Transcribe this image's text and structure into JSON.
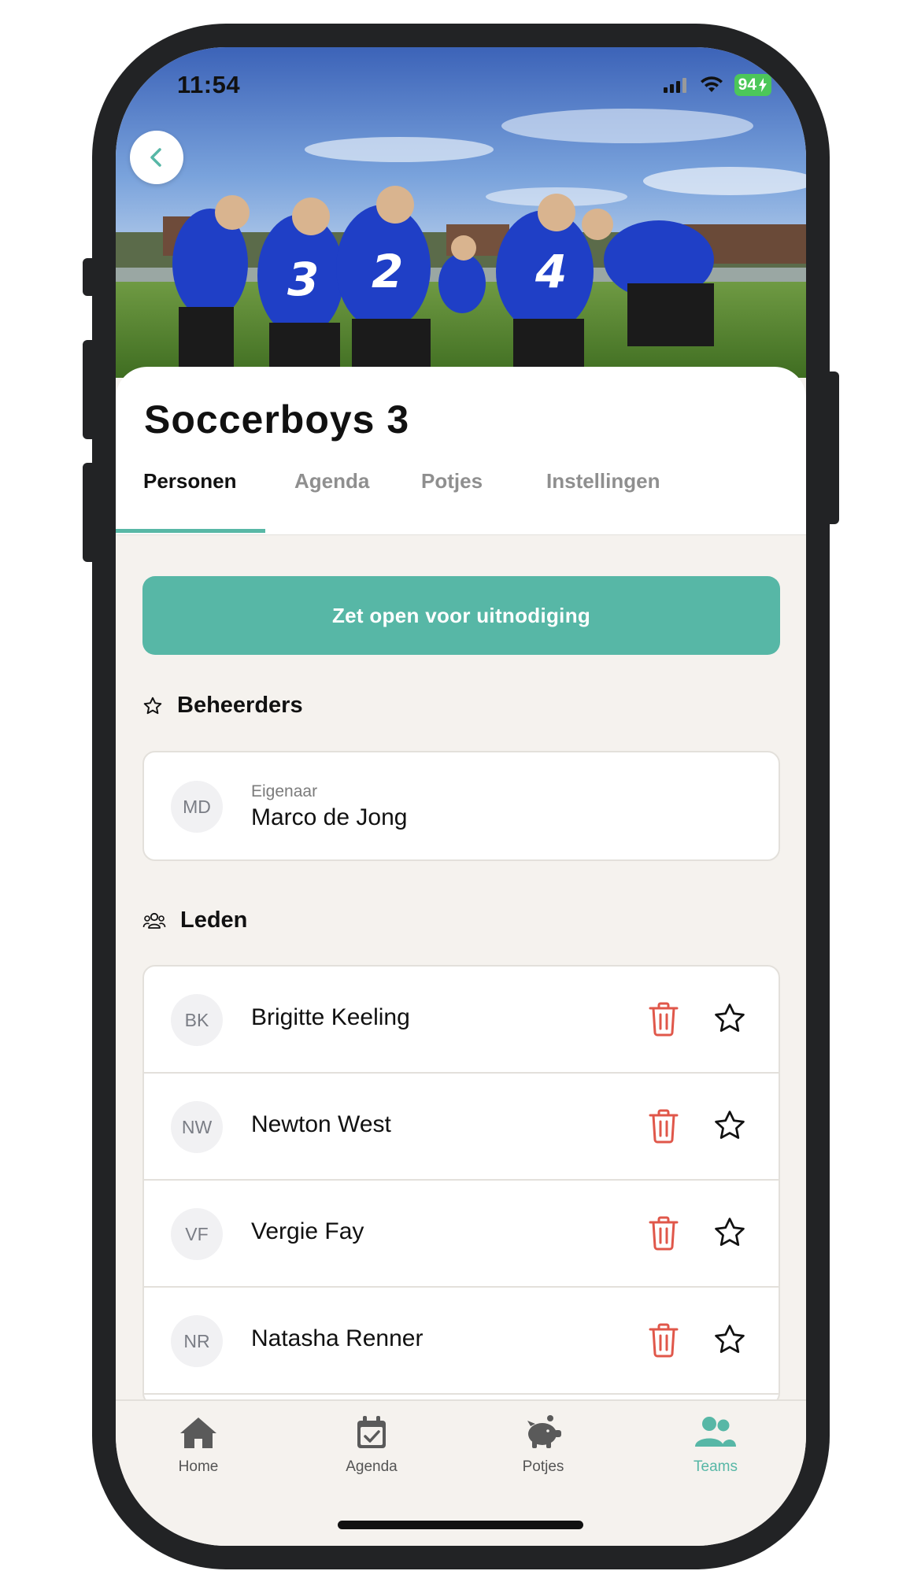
{
  "status_bar": {
    "time": "11:54",
    "battery": "94"
  },
  "hero": {
    "jersey_numbers": [
      "3",
      "2",
      "4"
    ]
  },
  "team": {
    "name": "Soccerboys 3"
  },
  "tabs": [
    {
      "label": "Personen",
      "active": true
    },
    {
      "label": "Agenda",
      "active": false
    },
    {
      "label": "Potjes",
      "active": false
    },
    {
      "label": "Instellingen",
      "active": false
    }
  ],
  "invite_button": {
    "label": "Zet open voor uitnodiging"
  },
  "admins": {
    "title": "Beheerders",
    "items": [
      {
        "initials": "MD",
        "role": "Eigenaar",
        "name": "Marco de Jong"
      }
    ]
  },
  "members": {
    "title": "Leden",
    "items": [
      {
        "initials": "BK",
        "name": "Brigitte Keeling"
      },
      {
        "initials": "NW",
        "name": "Newton West"
      },
      {
        "initials": "VF",
        "name": "Vergie Fay"
      },
      {
        "initials": "NR",
        "name": "Natasha Renner"
      }
    ]
  },
  "bottom_nav": [
    {
      "label": "Home",
      "icon": "home-icon",
      "active": false
    },
    {
      "label": "Agenda",
      "icon": "calendar-check-icon",
      "active": false
    },
    {
      "label": "Potjes",
      "icon": "piggy-bank-icon",
      "active": false
    },
    {
      "label": "Teams",
      "icon": "users-icon",
      "active": true
    }
  ],
  "colors": {
    "accent": "#57b7a6",
    "danger": "#e0574a",
    "background": "#f5f2ee",
    "jersey": "#1f3fc6"
  }
}
